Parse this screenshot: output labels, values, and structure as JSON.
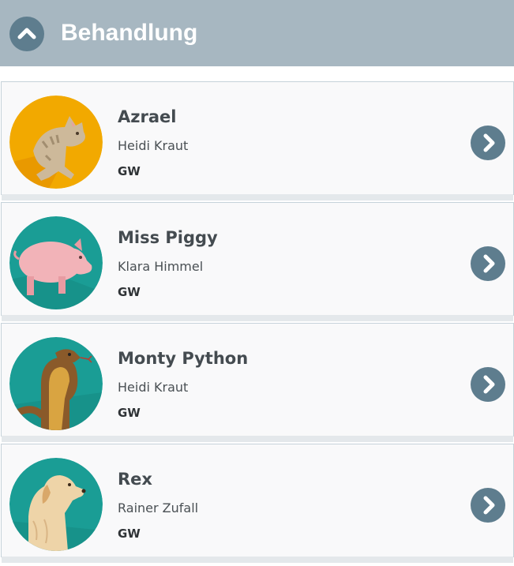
{
  "header": {
    "title": "Behandlung",
    "collapse_icon": "chevron-up-icon"
  },
  "colors": {
    "header_bg": "#a7b7c1",
    "button_bg": "#5e7d8e",
    "card_bg": "#f9f9fa"
  },
  "patients": [
    {
      "name": "Azrael",
      "owner": "Heidi Kraut",
      "code": "GW",
      "avatar": "cat-avatar",
      "avatar_bg": "#f2a900"
    },
    {
      "name": "Miss Piggy",
      "owner": "Klara Himmel",
      "code": "GW",
      "avatar": "pig-avatar",
      "avatar_bg": "#1a9d95"
    },
    {
      "name": "Monty Python",
      "owner": "Heidi Kraut",
      "code": "GW",
      "avatar": "snake-avatar",
      "avatar_bg": "#1a9d95"
    },
    {
      "name": "Rex",
      "owner": "Rainer Zufall",
      "code": "GW",
      "avatar": "dog-avatar",
      "avatar_bg": "#1a9d95"
    }
  ]
}
